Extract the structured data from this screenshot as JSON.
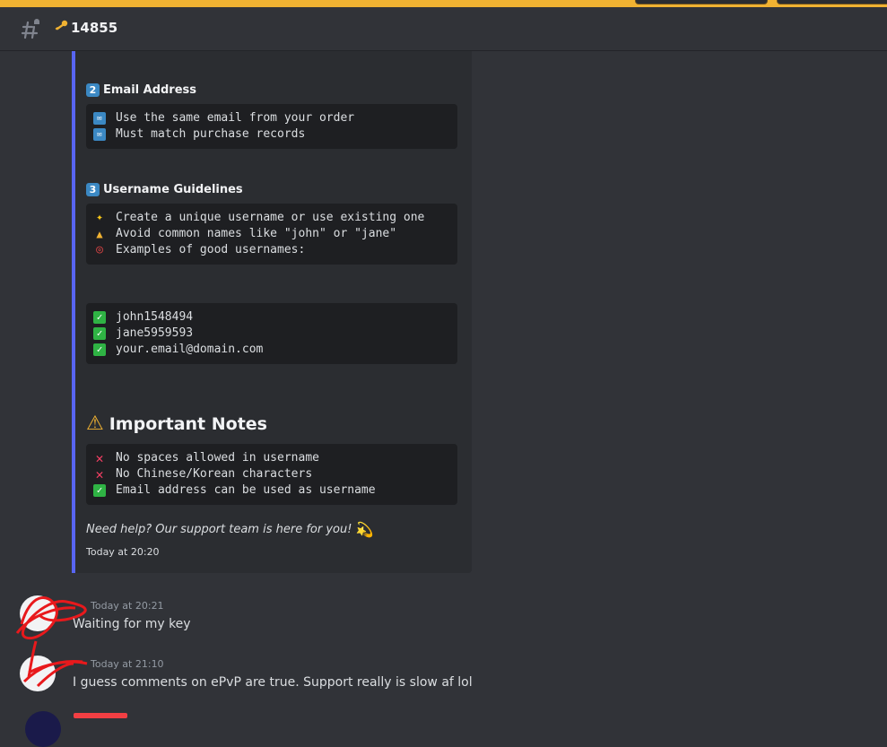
{
  "channel": {
    "name": "14855",
    "icon": "key-icon"
  },
  "embed": {
    "fields": [
      {
        "number": "2",
        "title": "Email Address",
        "lines": [
          {
            "icon": "email-icon",
            "text": "Use the same email from your order"
          },
          {
            "icon": "email-icon",
            "text": "Must match purchase records"
          }
        ]
      },
      {
        "number": "3",
        "title": "Username Guidelines",
        "lines": [
          {
            "icon": "sparkles-icon",
            "text": "Create a unique username or use existing one"
          },
          {
            "icon": "warning-icon",
            "text": "Avoid common names like \"john\" or \"jane\""
          },
          {
            "icon": "target-icon",
            "text": "Examples of good usernames:"
          }
        ]
      }
    ],
    "examples": [
      {
        "icon": "check-icon",
        "text": "john1548494"
      },
      {
        "icon": "check-icon",
        "text": "jane5959593"
      },
      {
        "icon": "check-icon",
        "text": "your.email@domain.com"
      }
    ],
    "important_title": "Important Notes",
    "notes": [
      {
        "icon": "cross-icon",
        "text": "No spaces allowed in username"
      },
      {
        "icon": "cross-icon",
        "text": "No Chinese/Korean characters"
      },
      {
        "icon": "check-icon",
        "text": "Email address can be used as username"
      }
    ],
    "footer_text": "Need help? Our support team is here for you!",
    "timestamp": "Today at 20:20"
  },
  "messages": [
    {
      "time": "Today at 20:21",
      "text": "Waiting for my key"
    },
    {
      "time": "Today at 21:10",
      "text": "I guess comments on ePvP are true. Support really is slow af lol"
    }
  ],
  "colors": {
    "accent": "#5865f2",
    "background": "#313338",
    "embed_bg": "#2b2d31",
    "code_bg": "#1e1f22",
    "top_strip": "#f0b232"
  }
}
